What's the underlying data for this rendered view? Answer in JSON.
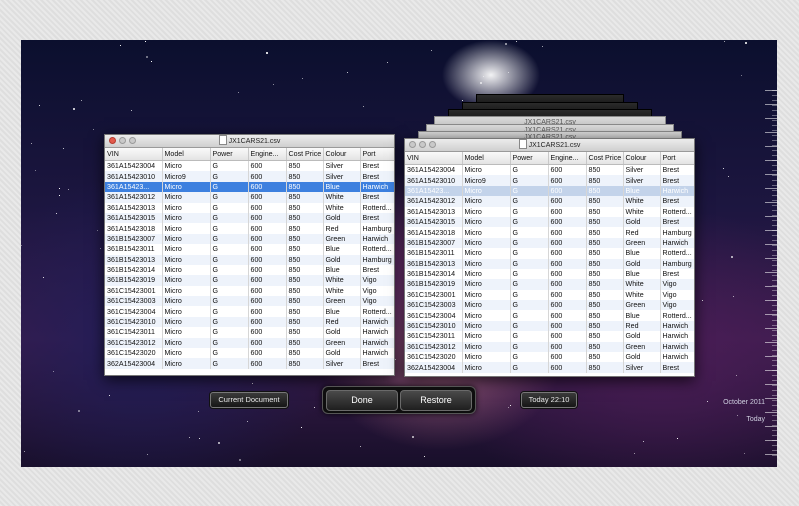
{
  "window_title": "JX1CARS21.csv",
  "stacked_titles": [
    "JX1CARS21.csv",
    "JX1CARS21.csv",
    "JX1CARS21.csv"
  ],
  "columns": [
    "VIN",
    "Model",
    "Power",
    "Engine...",
    "Cost Price",
    "Colour",
    "Port"
  ],
  "rows": [
    [
      "361A15423004",
      "Micro",
      "G",
      "600",
      "850",
      "Silver",
      "Brest"
    ],
    [
      "361A15423010",
      "Micro9",
      "G",
      "600",
      "850",
      "Silver",
      "Brest"
    ],
    [
      "361A15423...",
      "Micro",
      "G",
      "600",
      "850",
      "Blue",
      "Harwich"
    ],
    [
      "361A15423012",
      "Micro",
      "G",
      "600",
      "850",
      "White",
      "Brest"
    ],
    [
      "361A15423013",
      "Micro",
      "G",
      "600",
      "850",
      "White",
      "Rotterd..."
    ],
    [
      "361A15423015",
      "Micro",
      "G",
      "600",
      "850",
      "Gold",
      "Brest"
    ],
    [
      "361A15423018",
      "Micro",
      "G",
      "600",
      "850",
      "Red",
      "Hamburg"
    ],
    [
      "361B15423007",
      "Micro",
      "G",
      "600",
      "850",
      "Green",
      "Harwich"
    ],
    [
      "361B15423011",
      "Micro",
      "G",
      "600",
      "850",
      "Blue",
      "Rotterd..."
    ],
    [
      "361B15423013",
      "Micro",
      "G",
      "600",
      "850",
      "Gold",
      "Hamburg"
    ],
    [
      "361B15423014",
      "Micro",
      "G",
      "600",
      "850",
      "Blue",
      "Brest"
    ],
    [
      "361B15423019",
      "Micro",
      "G",
      "600",
      "850",
      "White",
      "Vigo"
    ],
    [
      "361C15423001",
      "Micro",
      "G",
      "600",
      "850",
      "White",
      "Vigo"
    ],
    [
      "361C15423003",
      "Micro",
      "G",
      "600",
      "850",
      "Green",
      "Vigo"
    ],
    [
      "361C15423004",
      "Micro",
      "G",
      "600",
      "850",
      "Blue",
      "Rotterd..."
    ],
    [
      "361C15423010",
      "Micro",
      "G",
      "600",
      "850",
      "Red",
      "Harwich"
    ],
    [
      "361C15423011",
      "Micro",
      "G",
      "600",
      "850",
      "Gold",
      "Harwich"
    ],
    [
      "361C15423012",
      "Micro",
      "G",
      "600",
      "850",
      "Green",
      "Harwich"
    ],
    [
      "361C15423020",
      "Micro",
      "G",
      "600",
      "850",
      "Gold",
      "Harwich"
    ],
    [
      "362A15423004",
      "Micro",
      "G",
      "600",
      "850",
      "Silver",
      "Brest"
    ]
  ],
  "buttons": {
    "current_document": "Current Document",
    "done": "Done",
    "restore": "Restore",
    "today_time": "Today 22:10"
  },
  "timeline": {
    "month": "October 2011",
    "today": "Today"
  }
}
